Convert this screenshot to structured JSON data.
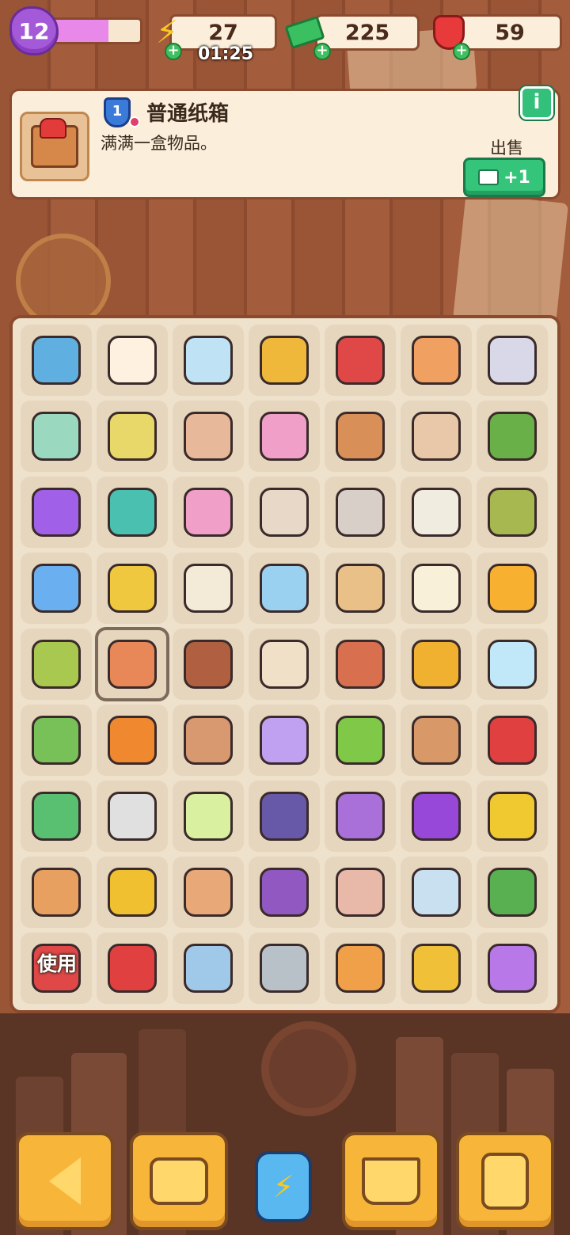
{
  "player": {
    "level": "12",
    "xp_progress": 0.65
  },
  "currencies": {
    "energy": {
      "value": "27",
      "timer": "01:25",
      "icon": "lightning-icon"
    },
    "cash": {
      "value": "225",
      "icon": "cash-stack-icon"
    },
    "gems": {
      "value": "59",
      "icon": "ruby-gem-icon"
    }
  },
  "info_panel": {
    "item_name": "普通纸箱",
    "item_level": "1",
    "item_desc": "满满一盒物品。",
    "info_button": "i",
    "sell_label": "出售",
    "sell_value": "+1"
  },
  "board": {
    "use_label": "使用",
    "items": [
      {
        "name": "blue-crate-item",
        "color": "#5fb0e0"
      },
      {
        "name": "lucky-cat-item",
        "color": "#fff1e0"
      },
      {
        "name": "ice-bench-item",
        "color": "#bfe3f5"
      },
      {
        "name": "gold-ring-item",
        "color": "#f0b83a"
      },
      {
        "name": "red-toolbox-item",
        "color": "#e04848"
      },
      {
        "name": "orange-vase-item",
        "color": "#f0a060"
      },
      {
        "name": "silver-toolbox-item",
        "color": "#d8d8e8"
      },
      {
        "name": "herb-bottle-item",
        "color": "#9ad8c0"
      },
      {
        "name": "seed-sack-item",
        "color": "#e8d86a"
      },
      {
        "name": "clay-vase-item",
        "color": "#e8b89a"
      },
      {
        "name": "flower-bed-item",
        "color": "#f0a0c8"
      },
      {
        "name": "pottery-crate-item",
        "color": "#d89058"
      },
      {
        "name": "striped-vase-item",
        "color": "#e8c8a8"
      },
      {
        "name": "flower-pot-item",
        "color": "#6ab048"
      },
      {
        "name": "purple-blob-item",
        "color": "#a060e8"
      },
      {
        "name": "first-aid-kit-item",
        "color": "#4ac0b0"
      },
      {
        "name": "flower-bed-large-item",
        "color": "#f0a0c8"
      },
      {
        "name": "fossil-bag-item",
        "color": "#e8d8c8"
      },
      {
        "name": "evidence-bag-item",
        "color": "#d8d0c8"
      },
      {
        "name": "photo-item",
        "color": "#f0ece0"
      },
      {
        "name": "green-tray-item",
        "color": "#a8b850"
      },
      {
        "name": "magnifier-item",
        "color": "#6ab0f0"
      },
      {
        "name": "sunglasses-item",
        "color": "#f0c840"
      },
      {
        "name": "note-card-item",
        "color": "#f4ead8"
      },
      {
        "name": "star-trophy-item",
        "color": "#9ad0f0"
      },
      {
        "name": "detective-box-item",
        "color": "#e8c088"
      },
      {
        "name": "portrait-item",
        "color": "#f8f0d8"
      },
      {
        "name": "juice-box-item",
        "color": "#f8b030"
      },
      {
        "name": "green-backpack-item",
        "color": "#a8c850"
      },
      {
        "name": "cardboard-box-item",
        "color": "#e88858"
      },
      {
        "name": "cone-stand-item",
        "color": "#b06040"
      },
      {
        "name": "wood-blocks-item",
        "color": "#f0e0c8"
      },
      {
        "name": "ornate-vase-item",
        "color": "#d87050"
      },
      {
        "name": "horseshoe-item",
        "color": "#f0b030"
      },
      {
        "name": "lamp-cube-item",
        "color": "#c0e8f8"
      },
      {
        "name": "potted-plant-item",
        "color": "#78c058"
      },
      {
        "name": "road-barrier-item",
        "color": "#f08830"
      },
      {
        "name": "broken-pot-item",
        "color": "#d89870"
      },
      {
        "name": "light-bulb-item",
        "color": "#c0a0f0"
      },
      {
        "name": "broom-item",
        "color": "#80c848"
      },
      {
        "name": "pottery-box-item",
        "color": "#d89868"
      },
      {
        "name": "red-case-item",
        "color": "#e04040"
      },
      {
        "name": "green-helmet-item",
        "color": "#58c070"
      },
      {
        "name": "stained-bed-item",
        "color": "#e0e0e0"
      },
      {
        "name": "soap-bottle-item",
        "color": "#d8f0a0"
      },
      {
        "name": "wheel-item",
        "color": "#6858a8"
      },
      {
        "name": "moth-item",
        "color": "#a870d8"
      },
      {
        "name": "scooter-item",
        "color": "#9848d8"
      },
      {
        "name": "barrier-post-item",
        "color": "#f0c830"
      },
      {
        "name": "pizza-boxes-item",
        "color": "#e8a060"
      },
      {
        "name": "caution-tape-item",
        "color": "#f0c030"
      },
      {
        "name": "stacked-boxes-item",
        "color": "#e8a878"
      },
      {
        "name": "bicycle-item",
        "color": "#9058c0"
      },
      {
        "name": "pebbles-item",
        "color": "#e8b8a8"
      },
      {
        "name": "thermometer-item",
        "color": "#c8e0f0"
      },
      {
        "name": "cabbage-item",
        "color": "#58b050"
      },
      {
        "name": "stamp-item",
        "color": "#e04848"
      },
      {
        "name": "red-gadget-item",
        "color": "#e04040"
      },
      {
        "name": "crime-map-item",
        "color": "#a0c8e8"
      },
      {
        "name": "broken-lamp-item",
        "color": "#b8c0c8"
      },
      {
        "name": "hand-lens-item",
        "color": "#f0a048"
      },
      {
        "name": "bucket-item",
        "color": "#f0c038"
      },
      {
        "name": "purple-car-item",
        "color": "#b878e8"
      }
    ]
  },
  "nav": {
    "back": "back-arrow-icon",
    "bag": "backpack-icon",
    "energy": "energy-jar-icon",
    "shop": "basket-icon",
    "tasks": "task-clipboard-icon"
  }
}
